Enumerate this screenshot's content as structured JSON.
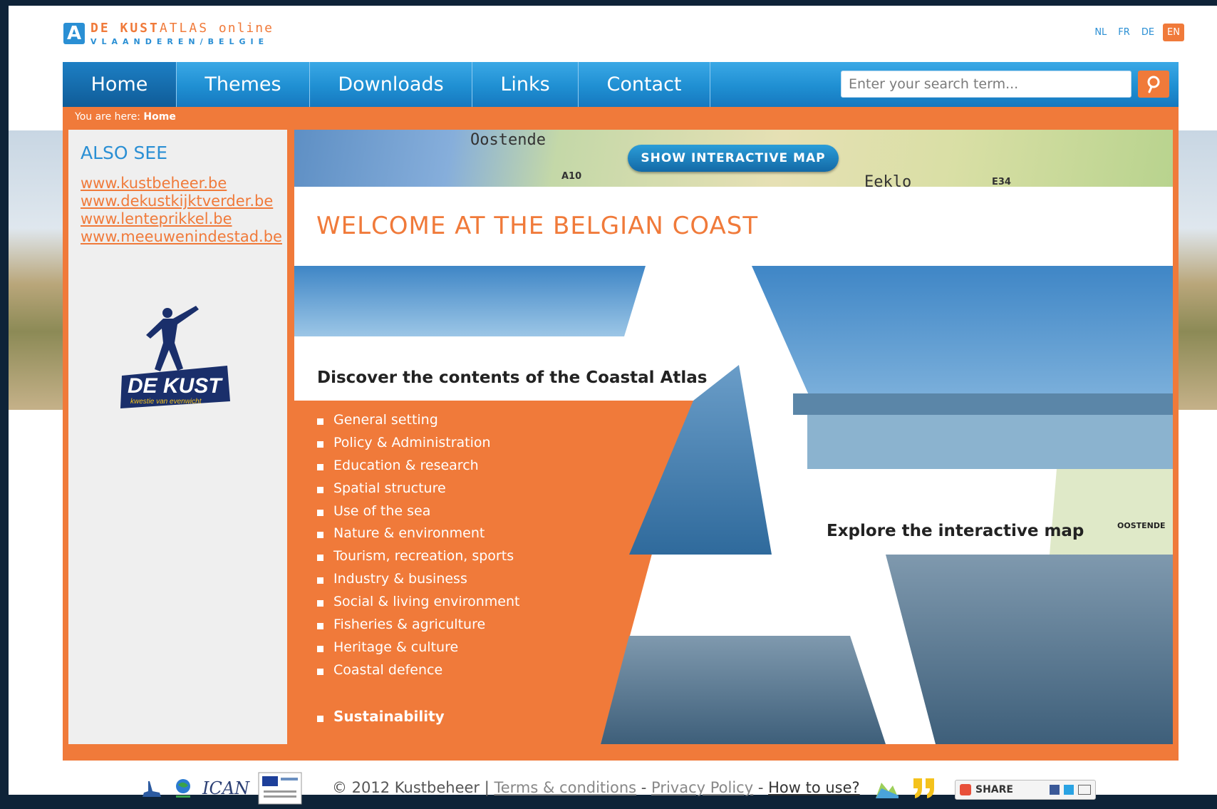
{
  "logo": {
    "mark": "A",
    "line1_a": "DE KUST",
    "line1_b": "ATLAS",
    "line1_c": "online",
    "line2": "VLAANDEREN/BELGIE"
  },
  "languages": [
    "NL",
    "FR",
    "DE",
    "EN"
  ],
  "active_language": "EN",
  "nav": {
    "items": [
      "Home",
      "Themes",
      "Downloads",
      "Links",
      "Contact"
    ],
    "active": "Home"
  },
  "search": {
    "placeholder": "Enter your search term..."
  },
  "breadcrumb": {
    "prefix": "You are here:",
    "current": "Home"
  },
  "sidebar": {
    "title": "ALSO SEE",
    "links": [
      "www.kustbeheer.be",
      "www.dekustkijktverder.be",
      "www.lenteprikkel.be",
      "www.meeuwenindestad.be"
    ],
    "badge_title": "DE KUST",
    "badge_subtitle": "kwestie van evenwicht"
  },
  "map_strip": {
    "button": "SHOW INTERACTIVE MAP",
    "labels": [
      "Oostende",
      "A10",
      "Eeklo",
      "E34"
    ]
  },
  "main": {
    "welcome": "WELCOME AT THE BELGIAN COAST",
    "discover": "Discover the contents of the Coastal Atlas",
    "themes": [
      "General setting",
      "Policy & Administration",
      "Education & research",
      "Spatial structure",
      "Use of the sea",
      "Nature & environment",
      "Tourism, recreation, sports",
      "Industry & business",
      "Social & living environment",
      "Fisheries & agriculture",
      "Heritage & culture",
      "Coastal defence"
    ],
    "sustainability": "Sustainability",
    "explore": "Explore the interactive map",
    "map_thumb_label": "OOSTENDE"
  },
  "footer": {
    "partner_logo_text": "ICAN",
    "copyright": "© 2012 Kustbeheer |",
    "terms": "Terms & conditions",
    "sep1": "-",
    "privacy": "Privacy Policy",
    "sep2": "-",
    "howto": "How to use?",
    "share": "SHARE"
  },
  "colors": {
    "orange": "#f07a3a",
    "blue": "#2a8fd4",
    "nav_dark": "#0f5c98"
  }
}
